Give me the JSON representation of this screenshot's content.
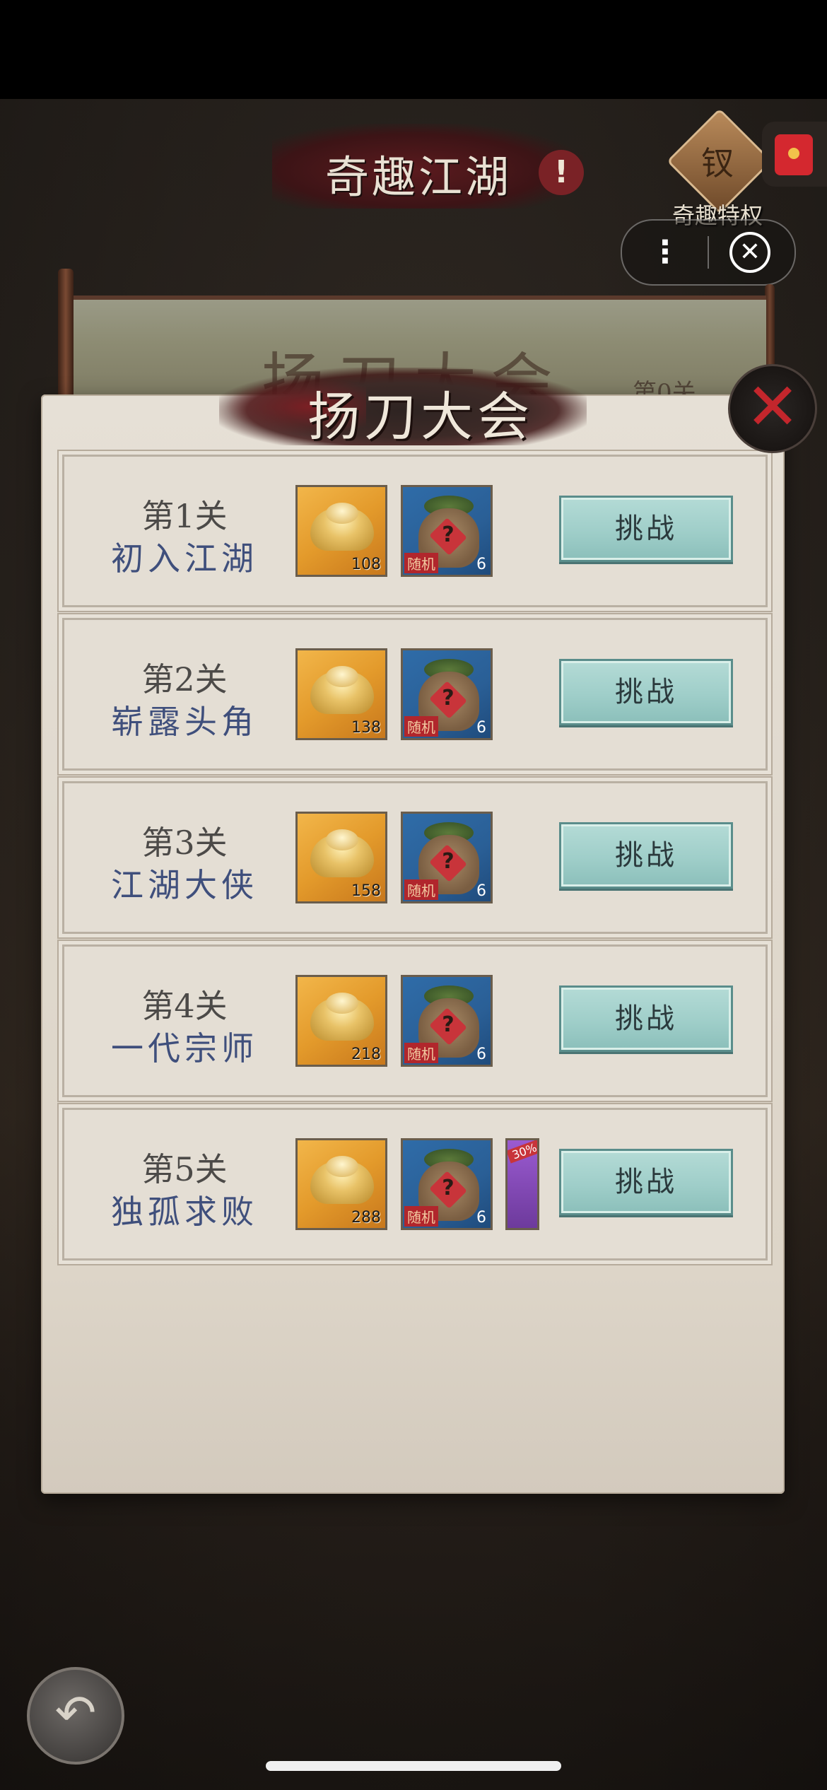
{
  "header": {
    "title": "奇趣江湖",
    "info_badge": "!",
    "privilege_label": "奇趣特权",
    "privilege_glyph": "钗"
  },
  "miniprogram": {
    "more_icon": "⋮",
    "close_icon": "✕"
  },
  "banner": {
    "ghost_title": "扬刀大会",
    "level_text": "第0关"
  },
  "panel": {
    "title": "扬刀大会",
    "close_icon": "✕"
  },
  "stages": [
    {
      "level": "第1关",
      "name": "初入江湖",
      "gold": "108",
      "bag_tag": "随机",
      "bag_count": "6",
      "button": "挑战"
    },
    {
      "level": "第2关",
      "name": "崭露头角",
      "gold": "138",
      "bag_tag": "随机",
      "bag_count": "6",
      "button": "挑战"
    },
    {
      "level": "第3关",
      "name": "江湖大侠",
      "gold": "158",
      "bag_tag": "随机",
      "bag_count": "6",
      "button": "挑战"
    },
    {
      "level": "第4关",
      "name": "一代宗师",
      "gold": "218",
      "bag_tag": "随机",
      "bag_count": "6",
      "button": "挑战"
    },
    {
      "level": "第5关",
      "name": "独孤求败",
      "gold": "288",
      "bag_tag": "随机",
      "bag_count": "6",
      "extra_tag": "30%",
      "button": "挑战"
    }
  ],
  "bottom": {
    "back_icon": "↶"
  },
  "colors": {
    "accent_red": "#c3262c",
    "button_teal": "#9fcec9",
    "stage_name_blue": "#3f4f7c"
  }
}
